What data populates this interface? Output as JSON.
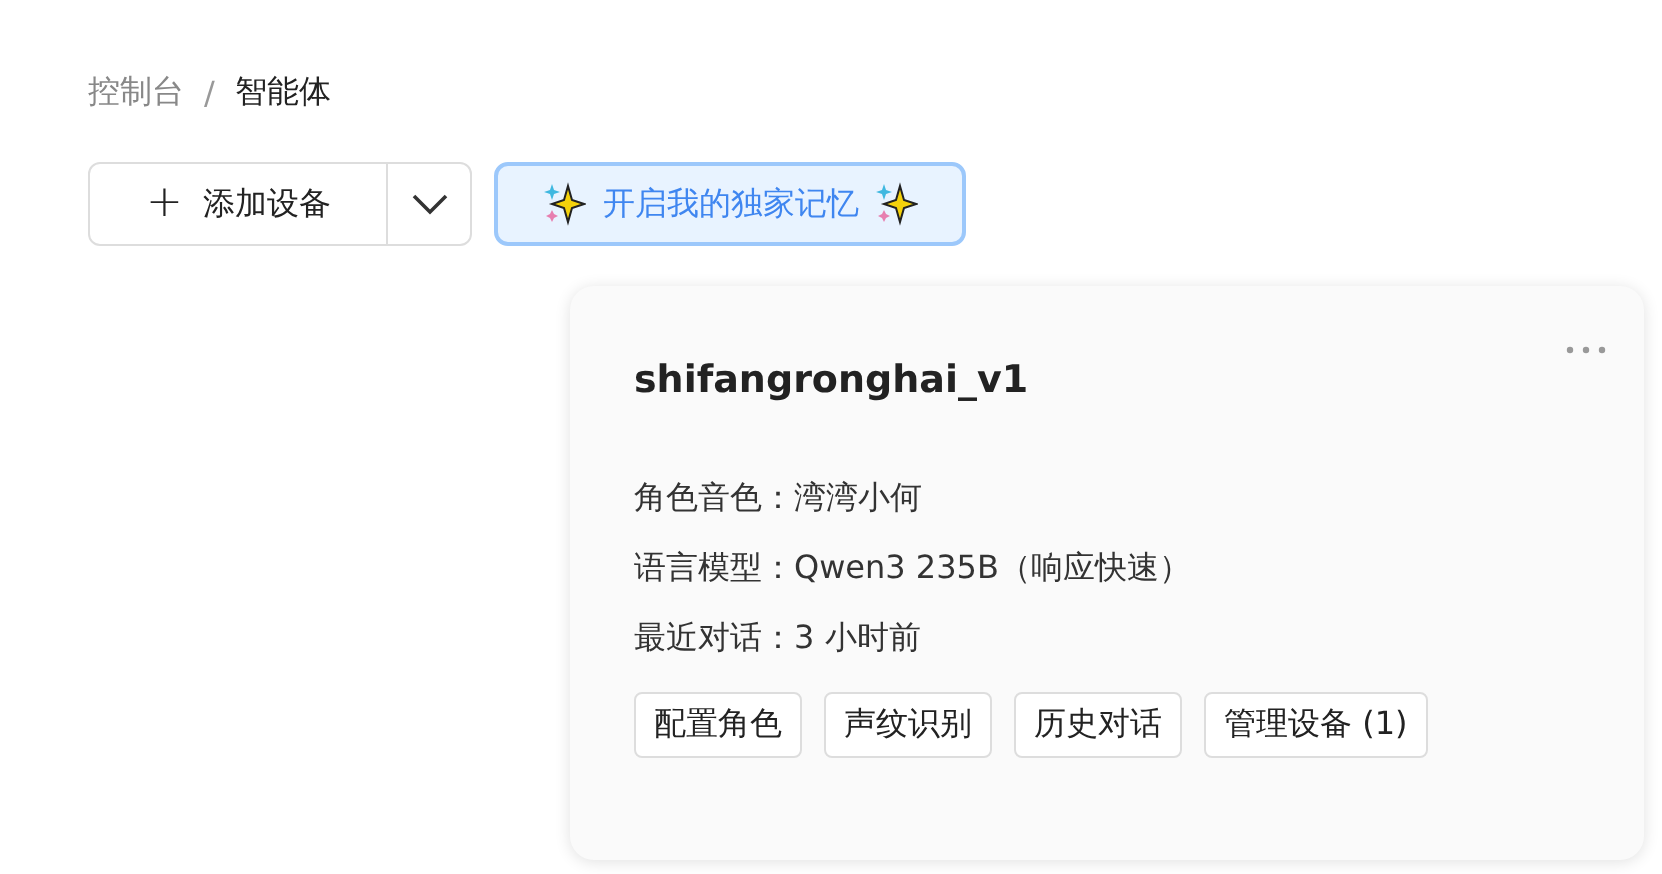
{
  "breadcrumb": [
    {
      "label": "控制台",
      "current": false
    },
    {
      "label": "智能体",
      "current": true
    }
  ],
  "breadcrumb_separator": "/",
  "toolbar": {
    "add_button": {
      "icon": "+",
      "label": "添加设备"
    },
    "memory_button": {
      "label": "开启我的独家记忆"
    }
  },
  "agent_card": {
    "title": "shifangronghai_v1",
    "details": [
      {
        "label": "角色音色：",
        "value": "湾湾小何"
      },
      {
        "label": "语言模型：",
        "value": "Qwen3 235B（响应快速）"
      },
      {
        "label": "最近对话：",
        "value": "3 小时前"
      }
    ],
    "actions": [
      "配置角色",
      "声纹识别",
      "历史对话",
      "管理设备 (1)"
    ]
  }
}
